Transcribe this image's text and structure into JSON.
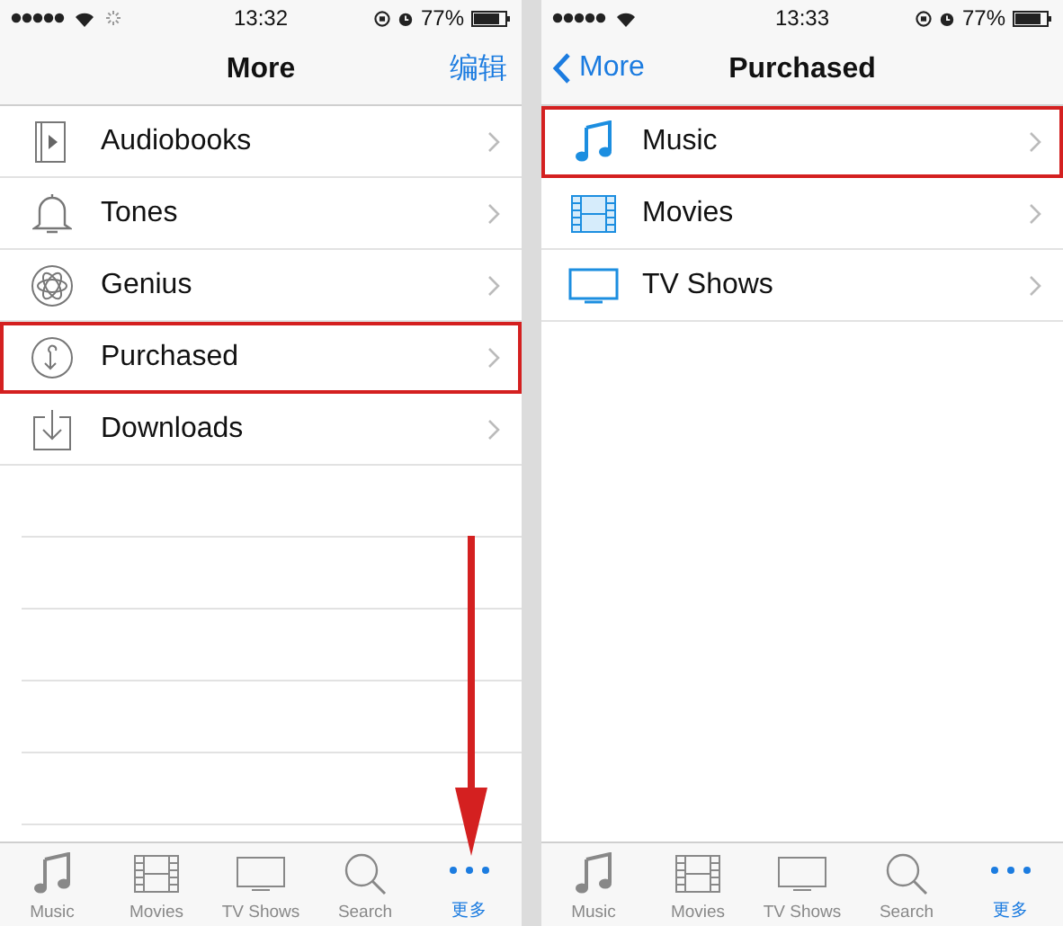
{
  "screens": [
    {
      "status_bar": {
        "loading": true,
        "time": "13:32",
        "battery": "77%"
      },
      "nav": {
        "title": "More",
        "action": "编辑"
      },
      "arrow": true,
      "rows": [
        {
          "kind": "audiobook",
          "label": "Audiobooks",
          "highlighted": false
        },
        {
          "kind": "bell",
          "label": "Tones",
          "highlighted": false
        },
        {
          "kind": "atom",
          "label": "Genius",
          "highlighted": false
        },
        {
          "kind": "purchased",
          "label": "Purchased",
          "highlighted": true
        },
        {
          "kind": "download",
          "label": "Downloads",
          "highlighted": false
        }
      ],
      "tabs": [
        {
          "kind": "music",
          "label": "Music",
          "selected": false
        },
        {
          "kind": "movies",
          "label": "Movies",
          "selected": false
        },
        {
          "kind": "tv",
          "label": "TV Shows",
          "selected": false
        },
        {
          "kind": "search",
          "label": "Search",
          "selected": false
        },
        {
          "kind": "more",
          "label": "更多",
          "selected": true
        }
      ]
    },
    {
      "status_bar": {
        "loading": false,
        "time": "13:33",
        "battery": "77%"
      },
      "nav": {
        "back": "More",
        "title": "Purchased"
      },
      "arrow": false,
      "rows": [
        {
          "kind": "music",
          "label": "Music",
          "highlighted": true
        },
        {
          "kind": "film",
          "label": "Movies",
          "highlighted": false
        },
        {
          "kind": "tv",
          "label": "TV Shows",
          "highlighted": false
        }
      ],
      "tabs": [
        {
          "kind": "music",
          "label": "Music",
          "selected": false
        },
        {
          "kind": "movies",
          "label": "Movies",
          "selected": false
        },
        {
          "kind": "tv",
          "label": "TV Shows",
          "selected": false
        },
        {
          "kind": "search",
          "label": "Search",
          "selected": false
        },
        {
          "kind": "more",
          "label": "更多",
          "selected": true
        }
      ]
    }
  ]
}
